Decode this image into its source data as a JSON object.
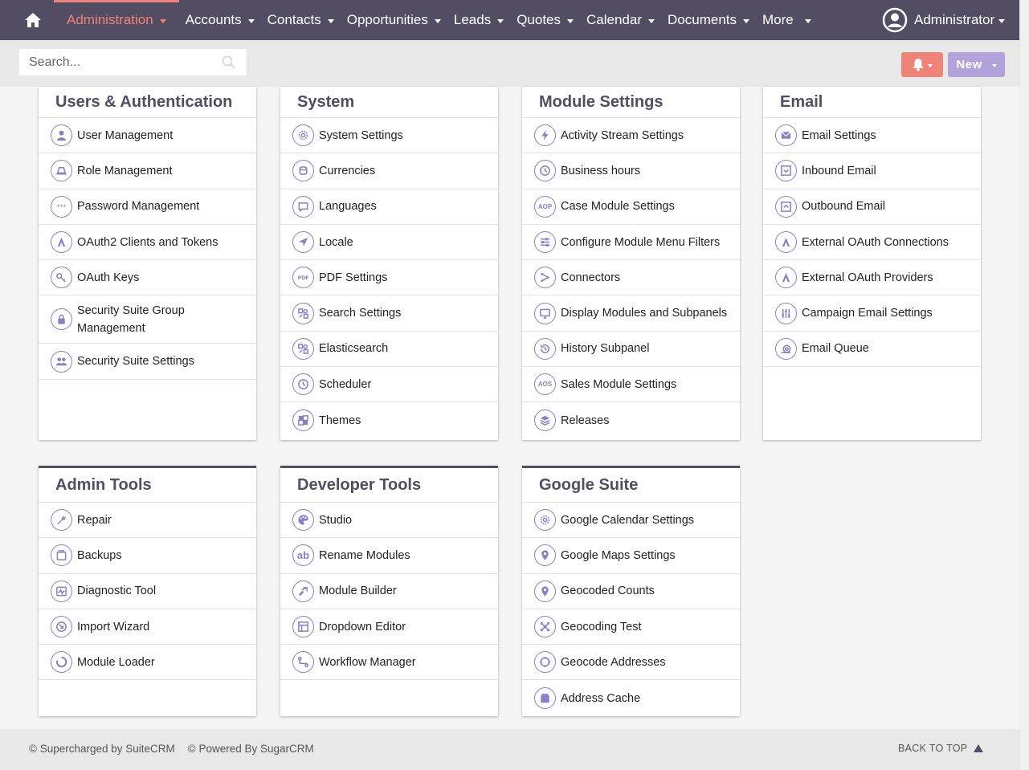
{
  "nav": {
    "items": [
      "Administration",
      "Accounts",
      "Contacts",
      "Opportunities",
      "Leads",
      "Quotes",
      "Calendar",
      "Documents",
      "More"
    ],
    "active": "Administration",
    "user": "Administrator"
  },
  "search": {
    "placeholder": "Search..."
  },
  "buttons": {
    "new_label": "New"
  },
  "colors": {
    "navbar": "#534d64",
    "accent": "#f08377",
    "new_button": "#b2a3db",
    "icon": "#8a7fc2"
  },
  "panels": [
    {
      "title": "Users & Authentication",
      "items": [
        {
          "label": "User Management",
          "icon": "user-icon"
        },
        {
          "label": "Role Management",
          "icon": "role-icon"
        },
        {
          "label": "Password Management",
          "icon": "password-icon"
        },
        {
          "label": "OAuth2 Clients and Tokens",
          "icon": "oauth-icon"
        },
        {
          "label": "OAuth Keys",
          "icon": "key-icon"
        },
        {
          "label": "Security Suite Group Management",
          "icon": "lock-icon"
        },
        {
          "label": "Security Suite Settings",
          "icon": "users-icon"
        }
      ]
    },
    {
      "title": "System",
      "items": [
        {
          "label": "System Settings",
          "icon": "gear-icon"
        },
        {
          "label": "Currencies",
          "icon": "coins-icon"
        },
        {
          "label": "Languages",
          "icon": "speech-bubble-icon"
        },
        {
          "label": "Locale",
          "icon": "location-arrow-icon"
        },
        {
          "label": "PDF Settings",
          "icon": "pdf-icon"
        },
        {
          "label": "Search Settings",
          "icon": "search-settings-icon"
        },
        {
          "label": "Elasticsearch",
          "icon": "elasticsearch-icon"
        },
        {
          "label": "Scheduler",
          "icon": "clock-icon"
        },
        {
          "label": "Themes",
          "icon": "themes-icon"
        }
      ]
    },
    {
      "title": "Module Settings",
      "items": [
        {
          "label": "Activity Stream Settings",
          "icon": "lightning-icon"
        },
        {
          "label": "Business hours",
          "icon": "clock-icon"
        },
        {
          "label": "Case Module Settings",
          "icon": "aop-icon"
        },
        {
          "label": "Configure Module Menu Filters",
          "icon": "sliders-icon"
        },
        {
          "label": "Connectors",
          "icon": "connectors-icon"
        },
        {
          "label": "Display Modules and Subpanels",
          "icon": "monitor-icon"
        },
        {
          "label": "History Subpanel",
          "icon": "history-icon"
        },
        {
          "label": "Sales Module Settings",
          "icon": "aos-icon"
        },
        {
          "label": "Releases",
          "icon": "layers-icon"
        }
      ]
    },
    {
      "title": "Email",
      "items": [
        {
          "label": "Email Settings",
          "icon": "envelope-icon"
        },
        {
          "label": "Inbound Email",
          "icon": "inbox-icon"
        },
        {
          "label": "Outbound Email",
          "icon": "outbox-icon"
        },
        {
          "label": "External OAuth Connections",
          "icon": "oauth-icon"
        },
        {
          "label": "External OAuth Providers",
          "icon": "oauth-icon"
        },
        {
          "label": "Campaign Email Settings",
          "icon": "equalizer-icon"
        },
        {
          "label": "Email Queue",
          "icon": "snail-icon"
        }
      ]
    },
    {
      "title": "Admin Tools",
      "items": [
        {
          "label": "Repair",
          "icon": "wrench-icon"
        },
        {
          "label": "Backups",
          "icon": "backup-icon"
        },
        {
          "label": "Diagnostic Tool",
          "icon": "pulse-icon"
        },
        {
          "label": "Import Wizard",
          "icon": "import-icon"
        },
        {
          "label": "Module Loader",
          "icon": "loader-icon"
        }
      ]
    },
    {
      "title": "Developer Tools",
      "items": [
        {
          "label": "Studio",
          "icon": "palette-icon"
        },
        {
          "label": "Rename Modules",
          "icon": "ab-icon"
        },
        {
          "label": "Module Builder",
          "icon": "builder-icon"
        },
        {
          "label": "Dropdown Editor",
          "icon": "dropdown-icon"
        },
        {
          "label": "Workflow Manager",
          "icon": "workflow-icon"
        }
      ]
    },
    {
      "title": "Google Suite",
      "items": [
        {
          "label": "Google Calendar Settings",
          "icon": "gear-icon"
        },
        {
          "label": "Google Maps Settings",
          "icon": "map-pin-icon"
        },
        {
          "label": "Geocoded Counts",
          "icon": "map-pin-icon"
        },
        {
          "label": "Geocoding Test",
          "icon": "arrows-icon"
        },
        {
          "label": "Geocode Addresses",
          "icon": "crosshair-icon"
        },
        {
          "label": "Address Cache",
          "icon": "cache-icon"
        }
      ]
    }
  ],
  "footer": {
    "supercharged": "© Supercharged by SuiteCRM",
    "powered": "© Powered By SugarCRM",
    "back_to_top": "BACK TO TOP"
  }
}
